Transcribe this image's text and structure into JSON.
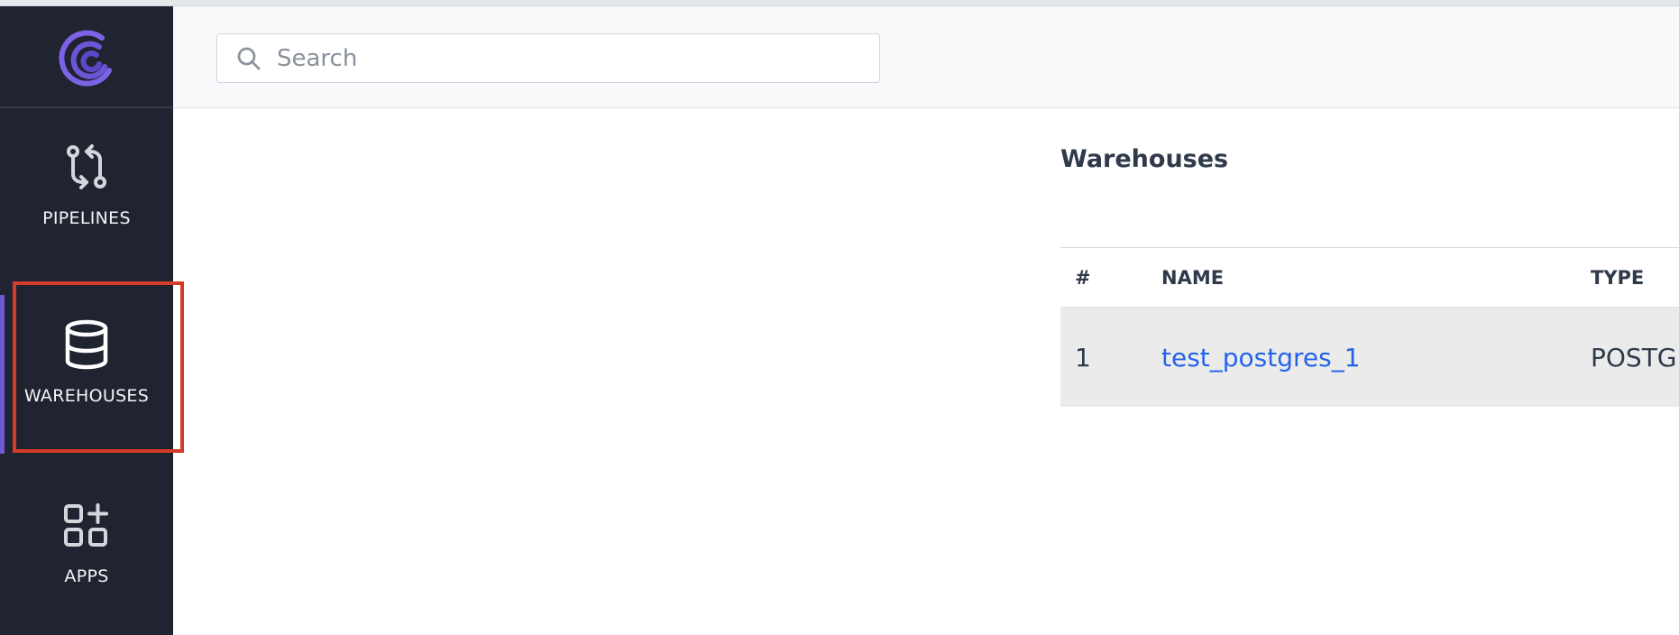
{
  "sidebar": {
    "items": [
      {
        "label": "PIPELINES",
        "icon": "pipelines-icon"
      },
      {
        "label": "WAREHOUSES",
        "icon": "database-icon",
        "active": true
      },
      {
        "label": "APPS",
        "icon": "apps-icon"
      }
    ]
  },
  "search": {
    "placeholder": "Search",
    "icon": "search-icon"
  },
  "main": {
    "title": "Warehouses",
    "table": {
      "headers": [
        "#",
        "NAME",
        "TYPE"
      ],
      "rows": [
        {
          "num": "1",
          "name": "test_postgres_1",
          "type": "POSTGRES"
        }
      ]
    }
  },
  "colors": {
    "sidebar_bg": "#1f2430",
    "accent": "#6d5bd0",
    "link": "#2563eb",
    "highlight_border": "#d43b28",
    "row_bg": "#ebebeb"
  }
}
